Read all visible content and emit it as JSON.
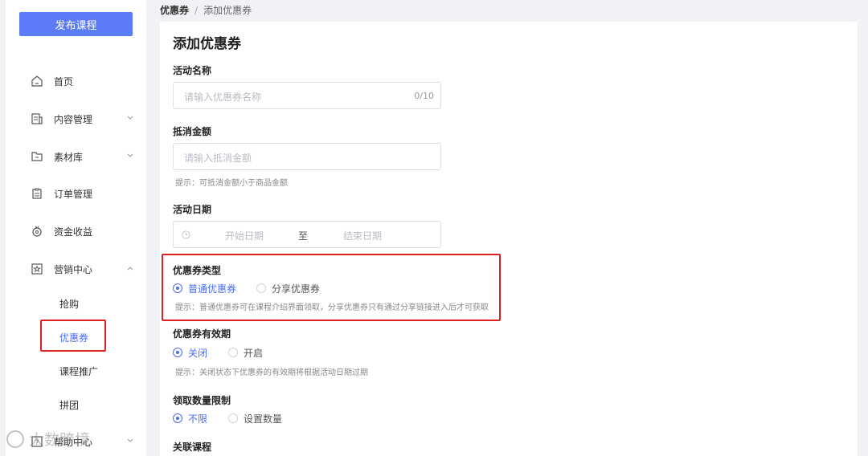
{
  "sidebar": {
    "publish_label": "发布课程",
    "items": [
      {
        "label": "首页",
        "icon": "home-icon"
      },
      {
        "label": "内容管理",
        "icon": "content-icon"
      },
      {
        "label": "素材库",
        "icon": "folder-icon"
      },
      {
        "label": "订单管理",
        "icon": "order-icon"
      },
      {
        "label": "资金收益",
        "icon": "money-icon"
      },
      {
        "label": "营销中心",
        "icon": "marketing-icon"
      }
    ],
    "sub_items": [
      {
        "label": "抢购"
      },
      {
        "label": "优惠券"
      },
      {
        "label": "课程推广"
      },
      {
        "label": "拼团"
      }
    ],
    "partial_item": "帮助中心"
  },
  "breadcrumb": {
    "parent": "优惠券",
    "separator": "/",
    "current": "添加优惠券"
  },
  "form": {
    "title": "添加优惠券",
    "name_label": "活动名称",
    "name_placeholder": "请输入优惠券名称",
    "name_count": "0/10",
    "amount_label": "抵消金额",
    "amount_placeholder": "请输入抵消金额",
    "amount_hint": "提示：可抵消金额小于商品金额",
    "date_label": "活动日期",
    "date_start_placeholder": "开始日期",
    "date_to": "至",
    "date_end_placeholder": "结束日期",
    "type_label": "优惠券类型",
    "type_option_1": "普通优惠券",
    "type_option_2": "分享优惠券",
    "type_hint": "提示：普通优惠券可在课程介绍界面领取，分享优惠券只有通过分享链接进入后才可获取",
    "validity_label": "优惠券有效期",
    "validity_option_1": "关闭",
    "validity_option_2": "开启",
    "validity_hint": "提示：关闭状态下优惠券的有效期将根据活动日期过期",
    "limit_label": "领取数量限制",
    "limit_option_1": "不限",
    "limit_option_2": "设置数量",
    "course_label": "关联课程"
  },
  "colors": {
    "primary": "#5b7cf6",
    "accent": "#4a6cf7",
    "highlight": "#e02020"
  },
  "watermark": "大数跨境"
}
